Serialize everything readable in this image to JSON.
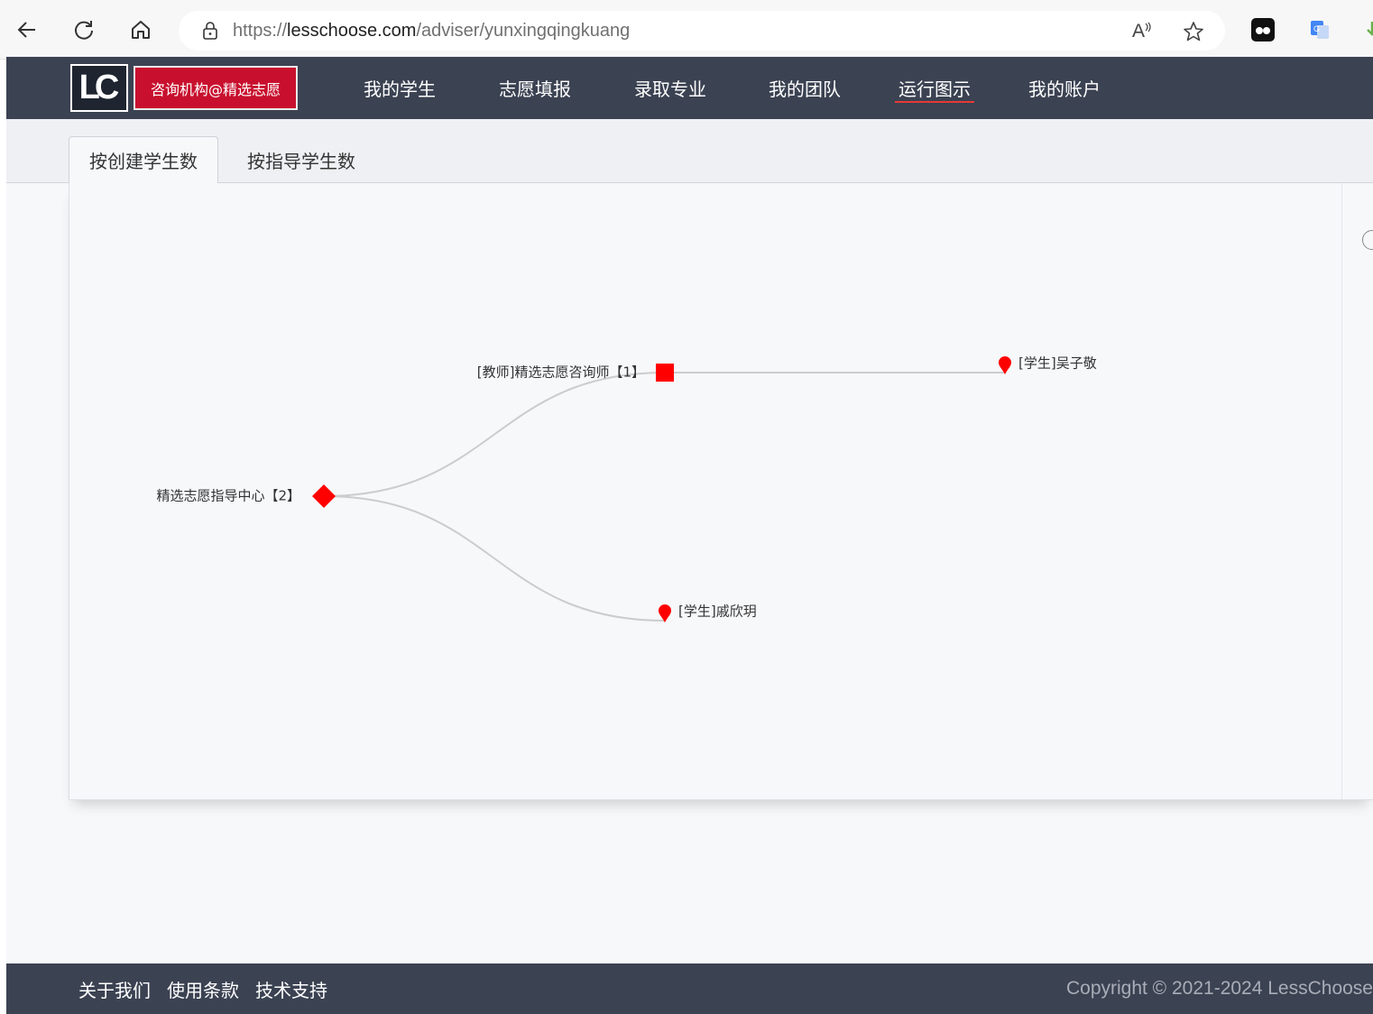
{
  "browser": {
    "url_scheme": "https://",
    "url_host": "lesschoose.com",
    "url_path": "/adviser/yunxingqingkuang",
    "read_aloud_label": "A"
  },
  "header": {
    "logo_text": "LC",
    "org_badge": "咨询机构@精选志愿",
    "nav": [
      {
        "label": "我的学生",
        "active": false
      },
      {
        "label": "志愿填报",
        "active": false
      },
      {
        "label": "录取专业",
        "active": false
      },
      {
        "label": "我的团队",
        "active": false
      },
      {
        "label": "运行图示",
        "active": true
      },
      {
        "label": "我的账户",
        "active": false
      }
    ],
    "accent_color": "#e53935",
    "bg_color": "#3b4252"
  },
  "tabs": [
    {
      "label": "按创建学生数",
      "active": true
    },
    {
      "label": "按指导学生数",
      "active": false
    }
  ],
  "tree": {
    "node_color": "#ff0000",
    "link_color": "#cccccc",
    "root": {
      "label": "精选志愿指导中心【2】",
      "symbol": "diamond"
    },
    "teacher": {
      "label": "[教师]精选志愿咨询师【1】",
      "symbol": "rect"
    },
    "students": [
      {
        "label": "[学生]吴子敬",
        "symbol": "pin"
      },
      {
        "label": "[学生]戚欣玥",
        "symbol": "pin"
      }
    ]
  },
  "footer": {
    "links": [
      "关于我们",
      "使用条款",
      "技术支持"
    ],
    "copyright": "Copyright © 2021-2024 LessChoose"
  }
}
